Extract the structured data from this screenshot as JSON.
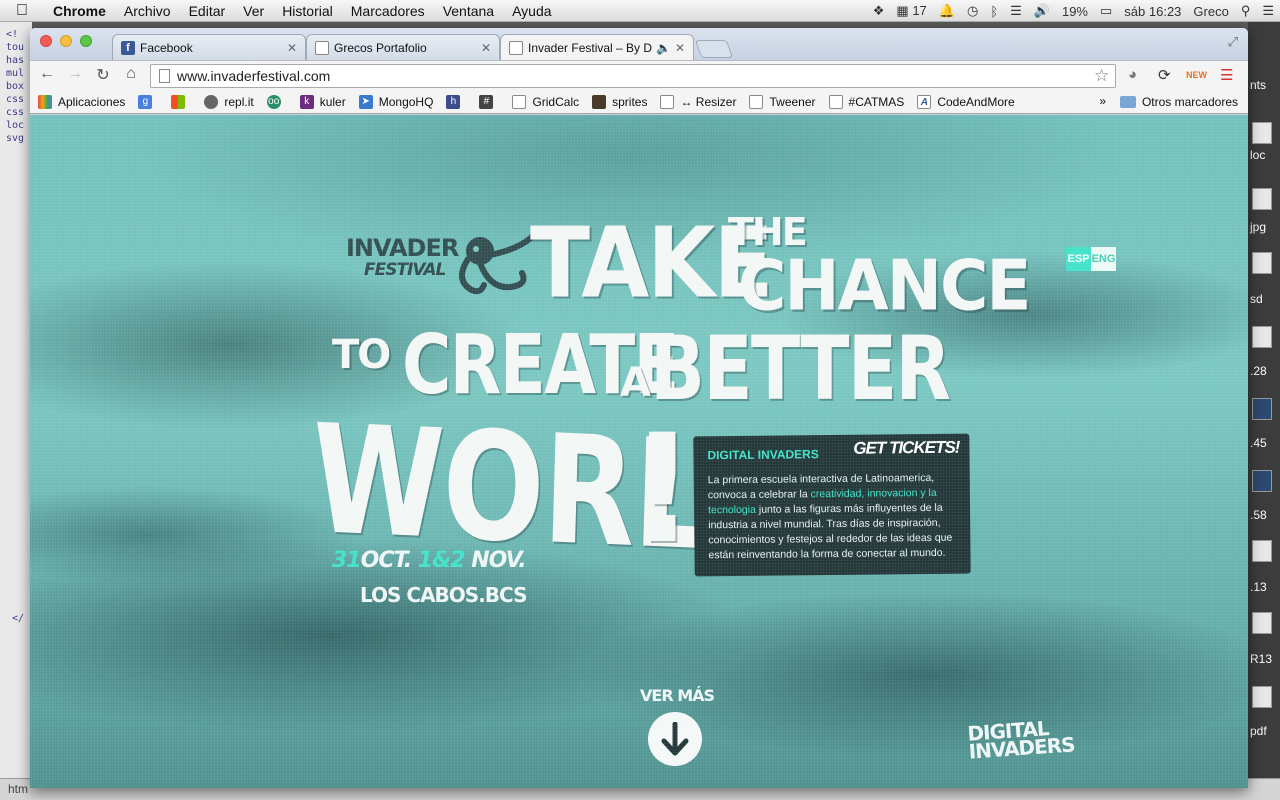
{
  "menubar": {
    "app": "Chrome",
    "items": [
      "Archivo",
      "Editar",
      "Ver",
      "Historial",
      "Marcadores",
      "Ventana",
      "Ayuda"
    ],
    "status": {
      "notifications": "17",
      "battery": "19%",
      "clock": "sáb 16:23",
      "user": "Greco"
    }
  },
  "desktop": {
    "left_lines": [
      "<!",
      "tou",
      "has",
      "mul",
      "box",
      "css",
      "css",
      "loc",
      "svg"
    ],
    "left_bottom": "</",
    "right_labels": [
      "nts",
      "loc",
      "jpg",
      "sd",
      ".28",
      ".45",
      ".58",
      ".13",
      "R13",
      "pdf"
    ],
    "bottom_text": "htm"
  },
  "tabs": [
    {
      "label": "Facebook",
      "icon": "facebook-icon"
    },
    {
      "label": "Grecos Portafolio",
      "icon": "page-icon"
    },
    {
      "label": "Invader Festival – By Dig",
      "icon": "page-icon"
    }
  ],
  "address": {
    "url": "www.invaderfestival.com"
  },
  "bookmarks": [
    {
      "label": "Aplicaciones",
      "icon": "apps-icon",
      "color": "#e04b3a"
    },
    {
      "label": "",
      "icon": "google-icon",
      "color": "#4a7fe0"
    },
    {
      "label": "",
      "icon": "windows-icon",
      "color": "#f2a31b"
    },
    {
      "label": "repl.it",
      "icon": "replit-icon",
      "color": "#666666"
    },
    {
      "label": "",
      "icon": "tripadvisor-icon",
      "color": "#2a8f66"
    },
    {
      "label": "kuler",
      "icon": "kuler-icon",
      "color": "#6b2e7e"
    },
    {
      "label": "MongoHQ",
      "icon": "rocket-icon",
      "color": "#3a7ad0"
    },
    {
      "label": "",
      "icon": "h-icon",
      "color": "#3b4b8e"
    },
    {
      "label": "",
      "icon": "hash-icon",
      "color": "#444444"
    },
    {
      "label": "GridCalc",
      "icon": "page-icon",
      "color": "#888888"
    },
    {
      "label": "sprites",
      "icon": "avatar-icon",
      "color": "#4a3a2a"
    },
    {
      "label": "↔ Resizer",
      "icon": "page-icon",
      "color": "#888888"
    },
    {
      "label": "Tweener",
      "icon": "page-icon",
      "color": "#888888"
    },
    {
      "label": "#CATMAS",
      "icon": "page-icon",
      "color": "#888888"
    },
    {
      "label": "CodeAndMore",
      "icon": "a-icon",
      "color": "#3b5b9e"
    }
  ],
  "bookmarks_overflow": "»",
  "bookmarks_other": "Otros marcadores",
  "page": {
    "logo": {
      "top": "INVADER",
      "sub": "FESTIVAL"
    },
    "headline": {
      "take": "TAKE",
      "the": "THE",
      "chance": "CHANCE",
      "to": "TO",
      "create": "CREATE",
      "a": "A",
      "better": "BETTER",
      "world": "WORLD",
      "bang": "!"
    },
    "date": {
      "d1": "31",
      "m1": "OCT.",
      "d2": "1&2",
      "m2": "NOV."
    },
    "place": "LOS CABOS.BCS",
    "lang": {
      "esp": "ESP",
      "eng": "ENG"
    },
    "info": {
      "title": "DIGITAL INVADERS",
      "tickets": "GET TICKETS!",
      "text_1": "La primera escuela interactiva de Latinoamerica, convoca a celebrar la ",
      "highlight": "creatividad, innovacion y la tecnologia",
      "text_2": " junto a las figuras más influyentes de la industria a nivel mundial. Tras días de inspiración, conocimientos y festejos al rededor de las ideas que están reinventando la forma de conectar al mundo."
    },
    "ver_mas": "VER MÁS",
    "footer_logo": {
      "line1": "DIGITAL",
      "line2": "INVADERS"
    }
  },
  "colors": {
    "accent": "#3de3c8",
    "info_bg": "#1f3335",
    "sea": "#6fbfba"
  }
}
